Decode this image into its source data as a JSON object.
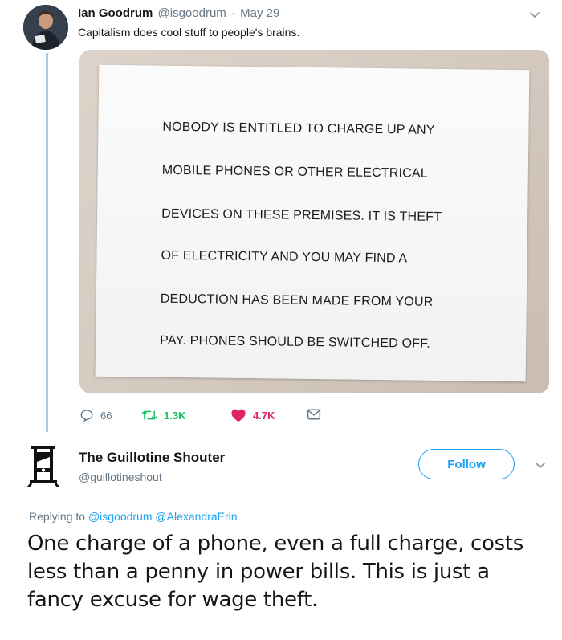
{
  "tweet1": {
    "author_name": "Ian Goodrum",
    "handle": "@isgoodrum",
    "separator": "·",
    "date": "May 29",
    "text": "Capitalism does cool stuff to people's brains.",
    "photo": {
      "sign_lines": [
        "NOBODY IS ENTITLED TO CHARGE UP ANY",
        "MOBILE PHONES OR OTHER ELECTRICAL",
        "DEVICES ON THESE PREMISES.  IT IS THEFT",
        "OF ELECTRICITY AND YOU MAY FIND A",
        "DEDUCTION HAS BEEN MADE FROM YOUR",
        "PAY. PHONES SHOULD BE SWITCHED OFF."
      ]
    },
    "actions": {
      "reply_icon": "reply-icon",
      "reply_count": "66",
      "retweet_icon": "retweet-icon",
      "retweet_count": "1.3K",
      "like_icon": "heart-icon",
      "like_count": "4.7K",
      "dm_icon": "envelope-icon"
    },
    "colors": {
      "retweet": "#17bf63",
      "like": "#e0245e",
      "thread_line": "#a5cbee"
    }
  },
  "tweet2": {
    "author_name": "The Guillotine Shouter",
    "handle": "@guillotineshout",
    "follow_label": "Follow",
    "replying_prefix": "Replying to",
    "mentions": [
      "@isgoodrum",
      "@AlexandraErin"
    ],
    "text": "One charge of a phone, even a full charge, costs less than a penny in power bills. This is just a fancy excuse for wage theft.",
    "avatar_icon": "guillotine-icon",
    "colors": {
      "accent": "#1da1f2",
      "secondary_text": "#657786"
    }
  }
}
